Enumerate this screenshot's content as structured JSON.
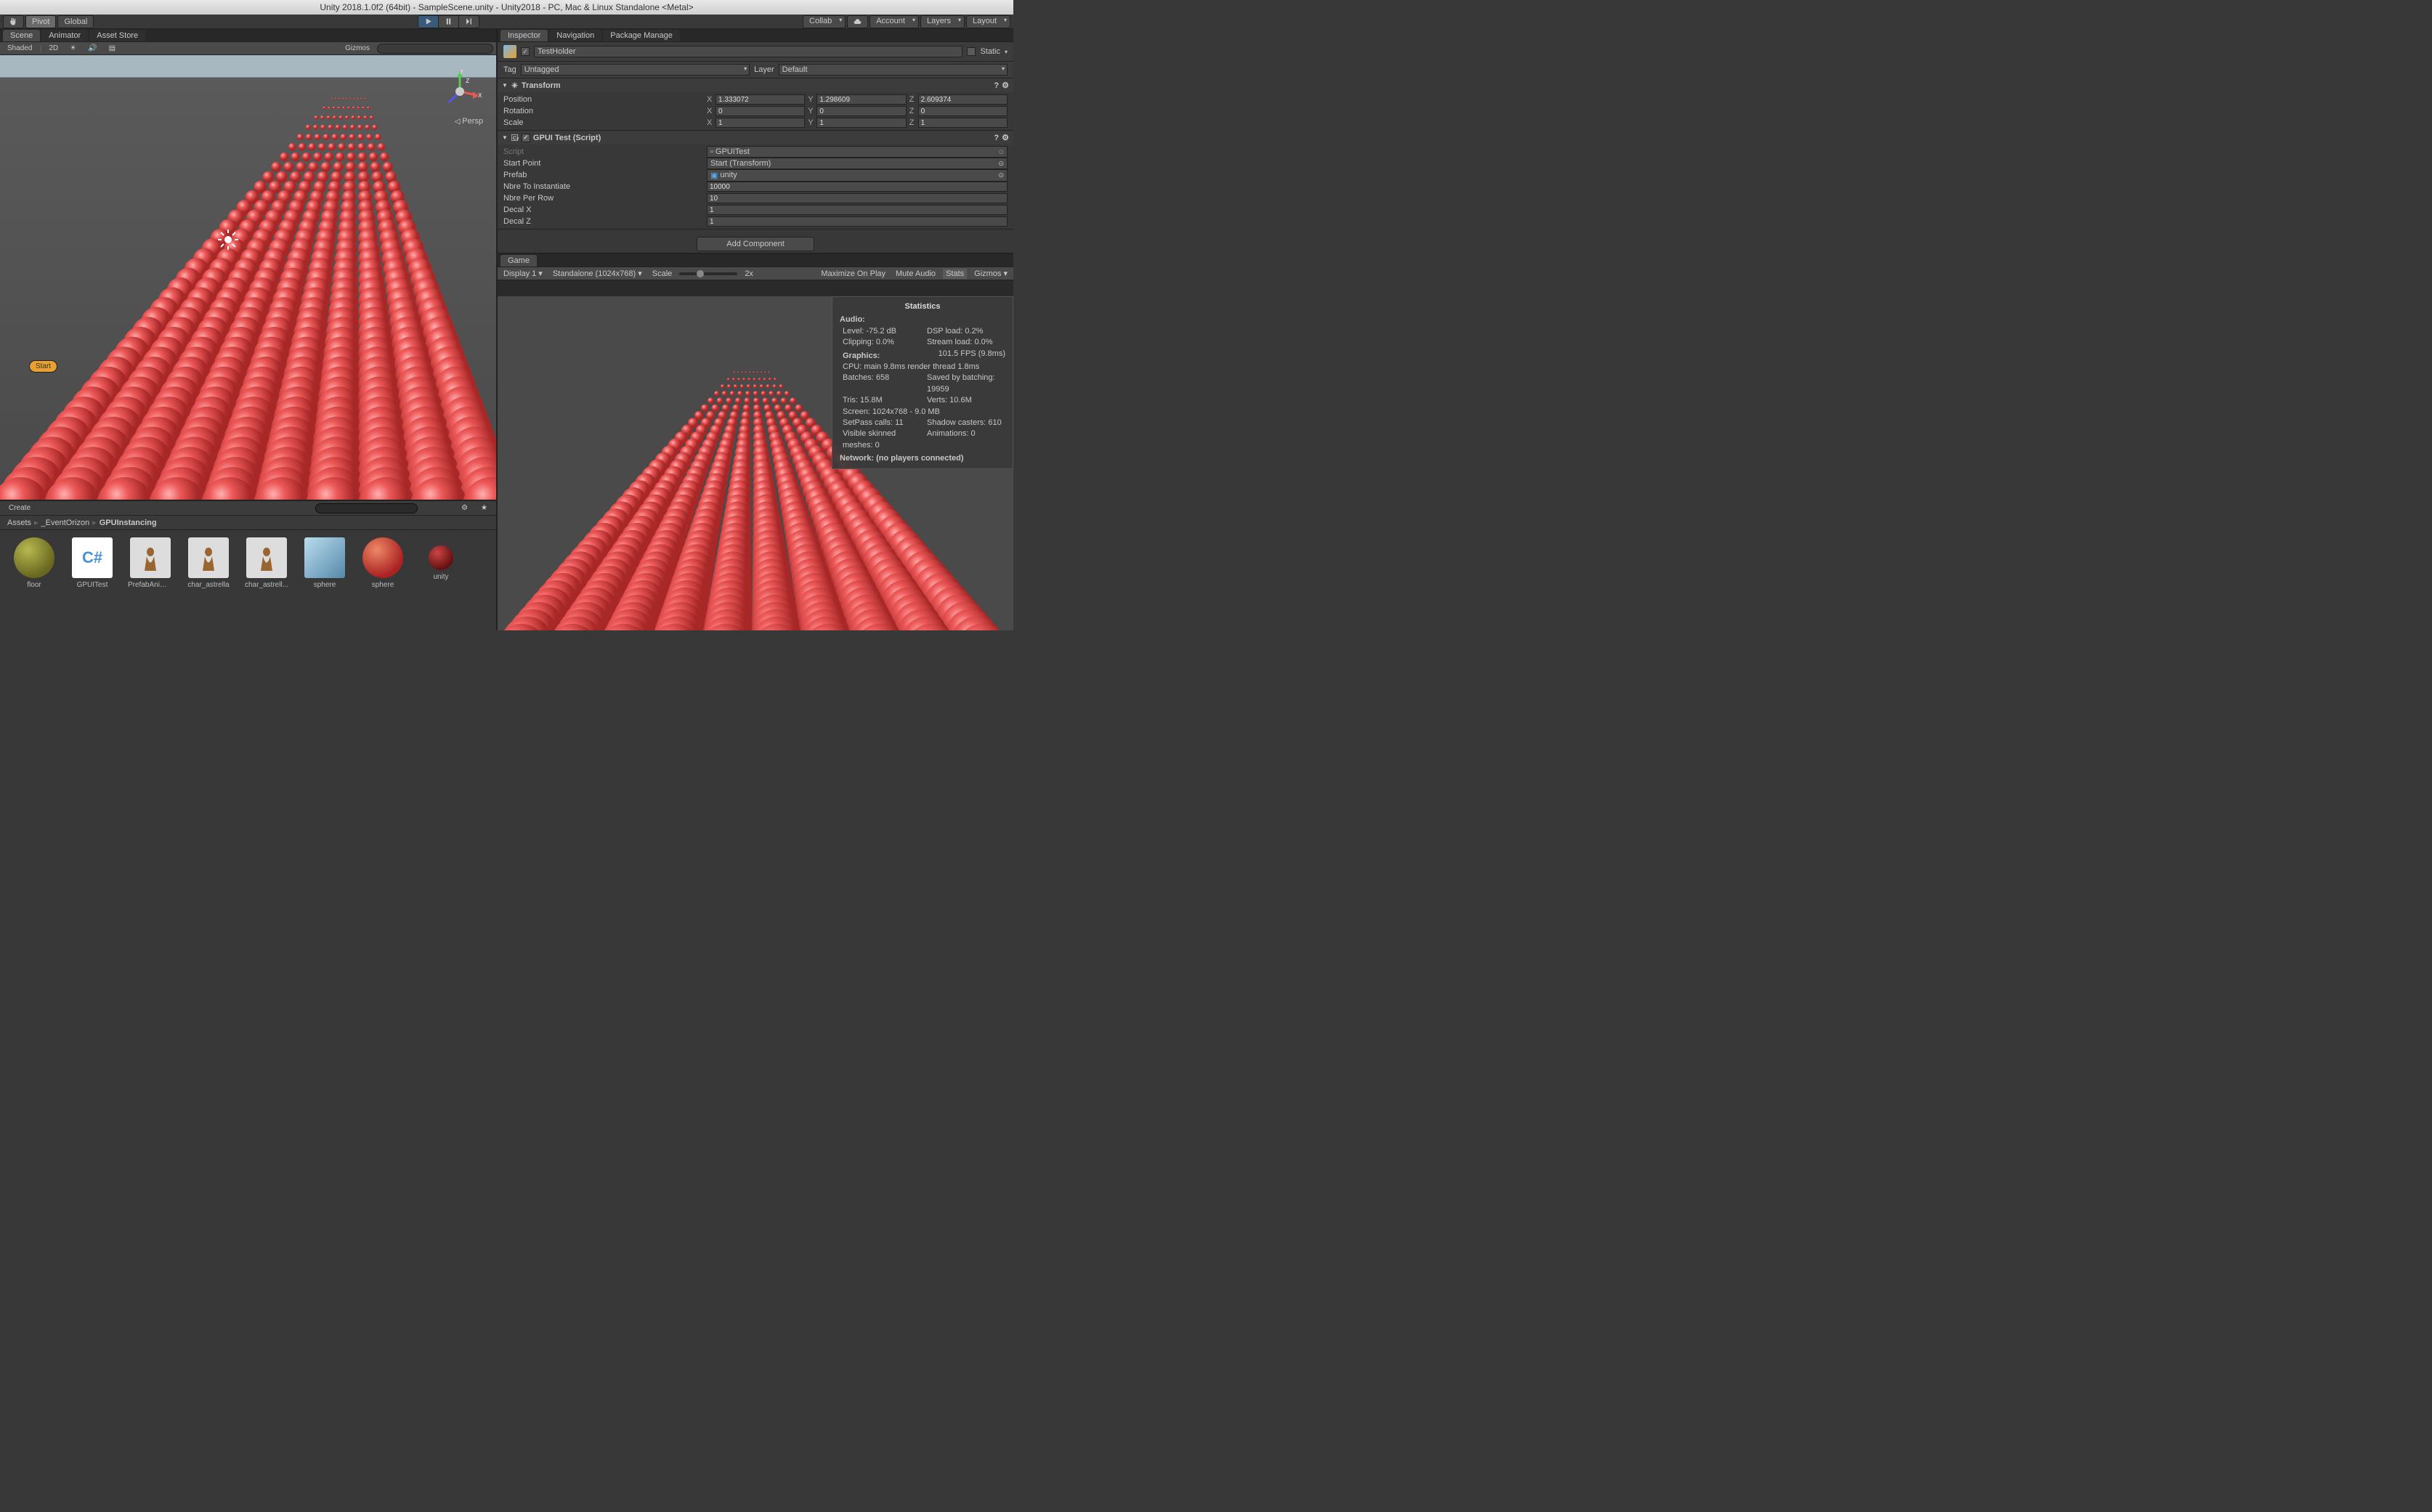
{
  "titlebar": "Unity 2018.1.0f2 (64bit) - SampleScene.unity - Unity2018 - PC, Mac & Linux Standalone <Metal>",
  "toolbar": {
    "pivot": "Pivot",
    "global": "Global",
    "collab": "Collab",
    "account": "Account",
    "layers": "Layers",
    "layout": "Layout"
  },
  "scene_tabs": {
    "scene": "Scene",
    "animator": "Animator",
    "asset_store": "Asset Store"
  },
  "scene_toolbar": {
    "shaded": "Shaded",
    "mode_2d": "2D",
    "gizmos": "Gizmos"
  },
  "scene_view": {
    "persp": "Persp",
    "start_label": "Start",
    "axis_x": "x",
    "axis_y": "y",
    "axis_z": "z"
  },
  "project": {
    "create": "Create",
    "breadcrumb": {
      "root": "Assets",
      "folder1": "_EventOrizon",
      "folder2": "GPUInstancing"
    },
    "assets": [
      {
        "name": "floor",
        "thumb": "sphere-olive"
      },
      {
        "name": "GPUITest",
        "thumb": "cs"
      },
      {
        "name": "PrefabAnimat...",
        "thumb": "char"
      },
      {
        "name": "char_astrella",
        "thumb": "char"
      },
      {
        "name": "char_astrell...",
        "thumb": "char"
      },
      {
        "name": "sphere",
        "thumb": "cube"
      },
      {
        "name": "sphere",
        "thumb": "sphere-red"
      },
      {
        "name": "unity",
        "thumb": "sphere-darkred"
      }
    ]
  },
  "inspector_tabs": {
    "inspector": "Inspector",
    "navigation": "Navigation",
    "package": "Package Manage"
  },
  "inspector": {
    "obj_name": "TestHolder",
    "static": "Static",
    "tag_label": "Tag",
    "tag_value": "Untagged",
    "layer_label": "Layer",
    "layer_value": "Default",
    "transform": {
      "title": "Transform",
      "position": "Position",
      "rotation": "Rotation",
      "scale": "Scale",
      "pos": {
        "x": "1.333072",
        "y": "1.298609",
        "z": "2.609374"
      },
      "rot": {
        "x": "0",
        "y": "0",
        "z": "0"
      },
      "scl": {
        "x": "1",
        "y": "1",
        "z": "1"
      },
      "axis_x": "X",
      "axis_y": "Y",
      "axis_z": "Z"
    },
    "gpui": {
      "title": "GPUI Test (Script)",
      "script_label": "Script",
      "script_value": "GPUITest",
      "start_point_label": "Start Point",
      "start_point_value": "Start (Transform)",
      "prefab_label": "Prefab",
      "prefab_value": "unity",
      "nbre_inst_label": "Nbre To Instantiate",
      "nbre_inst_value": "10000",
      "nbre_row_label": "Nbre Per Row",
      "nbre_row_value": "10",
      "decal_x_label": "Decal X",
      "decal_x_value": "1",
      "decal_z_label": "Decal Z",
      "decal_z_value": "1"
    },
    "add_component": "Add Component"
  },
  "game_tab": "Game",
  "game_toolbar": {
    "display": "Display 1",
    "resolution": "Standalone (1024x768)",
    "scale": "Scale",
    "scale_val": "2x",
    "maximize": "Maximize On Play",
    "mute": "Mute Audio",
    "stats": "Stats",
    "gizmos": "Gizmos"
  },
  "stats": {
    "title": "Statistics",
    "audio": "Audio:",
    "level_label": "Level:",
    "level_val": "-75.2 dB",
    "dsp_label": "DSP load:",
    "dsp_val": "0.2%",
    "clip_label": "Clipping:",
    "clip_val": "0.0%",
    "stream_label": "Stream load:",
    "stream_val": "0.0%",
    "graphics": "Graphics:",
    "fps": "101.5 FPS (9.8ms)",
    "cpu": "CPU: main 9.8ms  render thread 1.8ms",
    "batches": "Batches: 658",
    "saved": "Saved by batching: 19959",
    "tris": "Tris: 15.8M",
    "verts": "Verts: 10.6M",
    "screen": "Screen: 1024x768 - 9.0 MB",
    "setpass": "SetPass calls: 11",
    "shadow": "Shadow casters: 610",
    "skinned": "Visible skinned meshes: 0",
    "anim": "Animations: 0",
    "network": "Network: (no players connected)"
  }
}
